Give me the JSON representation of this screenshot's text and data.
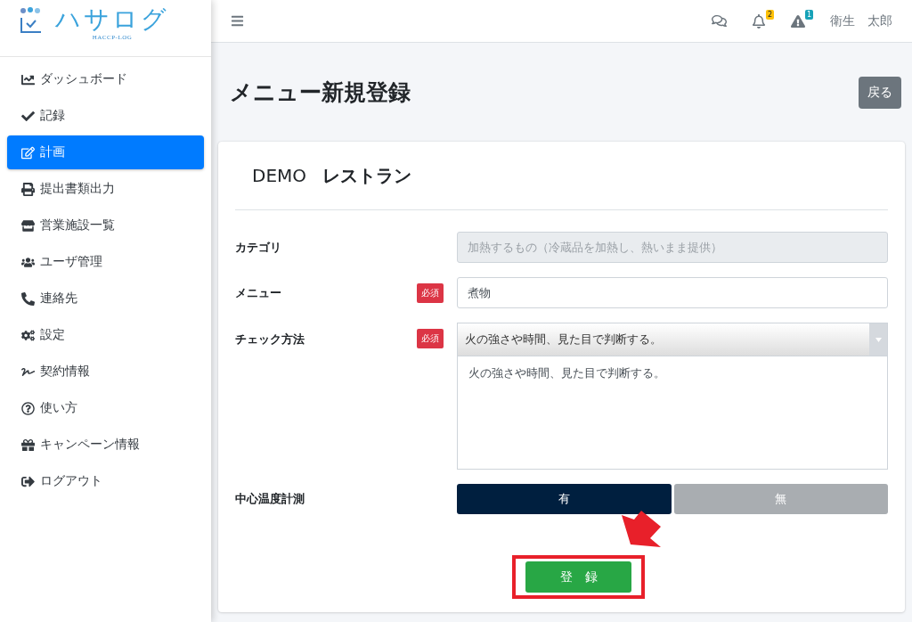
{
  "logo": {
    "text": "ハサログ",
    "subtitle": "HACCP-LOG"
  },
  "sidebar": {
    "items": [
      {
        "label": "ダッシュボード",
        "selected": false
      },
      {
        "label": "記録",
        "selected": false
      },
      {
        "label": "計画",
        "selected": true
      },
      {
        "label": "提出書類出力",
        "selected": false
      },
      {
        "label": "営業施設一覧",
        "selected": false
      },
      {
        "label": "ユーザ管理",
        "selected": false
      },
      {
        "label": "連絡先",
        "selected": false
      },
      {
        "label": "設定",
        "selected": false
      },
      {
        "label": "契約情報",
        "selected": false
      },
      {
        "label": "使い方",
        "selected": false
      },
      {
        "label": "キャンペーン情報",
        "selected": false
      },
      {
        "label": "ログアウト",
        "selected": false
      }
    ]
  },
  "header": {
    "notifications": [
      {
        "kind": "bell",
        "count": "2"
      },
      {
        "kind": "warning",
        "count": "1"
      }
    ],
    "user": "衛生　太郎"
  },
  "page": {
    "title": "メニュー新規登録",
    "back_button": "戻る"
  },
  "form": {
    "store_prefix": "DEMO",
    "store_name": "レストラン",
    "fields": [
      {
        "kind": "input",
        "label": "カテゴリ",
        "required": false,
        "disabled": true,
        "value": "加熱するもの（冷蔵品を加熱し、熱いまま提供）"
      },
      {
        "kind": "input",
        "label": "メニュー",
        "required": true,
        "required_badge": "必須",
        "disabled": false,
        "value": "煮物"
      },
      {
        "kind": "select_text",
        "label": "チェック方法",
        "required": true,
        "required_badge": "必須",
        "select_value": "火の強さや時間、見た目で判断する。",
        "text": "火の強さや時間、見た目で判断する。"
      },
      {
        "kind": "toggle",
        "label": "中心温度計測",
        "required": false,
        "options": [
          {
            "label": "有",
            "selected": true
          },
          {
            "label": "無",
            "selected": false
          }
        ]
      }
    ],
    "submit": "登　録"
  }
}
